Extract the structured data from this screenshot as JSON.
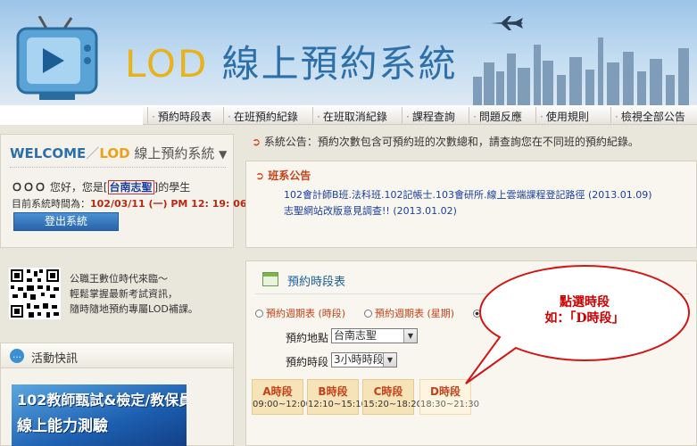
{
  "header": {
    "title_lod": "LOD",
    "title_rest": " 線上預約系統"
  },
  "nav": {
    "items": [
      "預約時段表",
      "在班預約紀錄",
      "在班取消紀錄",
      "課程查詢",
      "問題反應",
      "使用規則",
      "檢視全部公告"
    ]
  },
  "welcome": {
    "title_welcome": "WELCOME",
    "title_slash": "／",
    "title_lod": "LOD",
    "title_rest": " 線上預約系統",
    "title_arrow": "▼",
    "user_mask": "ＯＯＯ",
    "greeting": " 您好，您是[",
    "school": "台南志聖",
    "greeting_tail": "]的學生",
    "time_label": "目前系統時間為：",
    "time_value": "102/03/11 (一) PM 12: 19: 06",
    "logout_label": "登出系統"
  },
  "promo": {
    "lines": [
      "公職王數位時代來臨～",
      "輕鬆掌握最新考試資訊，",
      "隨時隨地預約專屬LOD補課。"
    ]
  },
  "activity": {
    "title": "活動快訊",
    "banner_line1": "102教師甄試&檢定/教保員",
    "banner_line2": "線上能力測驗"
  },
  "announcement": {
    "prefix": "系統公告：",
    "text": "預約次數包含可預約班的次數總和，請查詢您在不同班的預約紀錄。"
  },
  "class_announce": {
    "title": "班系公告",
    "items": [
      "102會計師B班.法科班.102記帳士.103會研所.線上雲端課程登記路徑 (2013.01.09)",
      "志聖網站改版意見調查!! (2013.01.02)"
    ]
  },
  "schedule": {
    "title": "預約時段表",
    "radios": [
      "預約週期表 (時段)",
      "預約週期表 (星期)",
      "預約"
    ],
    "location_label": "預約地點",
    "location_value": "台南志聖",
    "period_label": "預約時段",
    "period_value": "3小時時段",
    "slots": [
      {
        "name": "A時段",
        "time": "09:00~12:00"
      },
      {
        "name": "B時段",
        "time": "12:10~15:10"
      },
      {
        "name": "C時段",
        "time": "15:20~18:20"
      },
      {
        "name": "D時段",
        "time": "18:30~21:30"
      }
    ]
  },
  "callout": {
    "line1": "點選時段",
    "line2": "如：「D時段」"
  },
  "colors": {
    "brand_blue": "#2d6fa8",
    "brand_gold": "#e8b21c",
    "accent_red": "#c4421a"
  }
}
